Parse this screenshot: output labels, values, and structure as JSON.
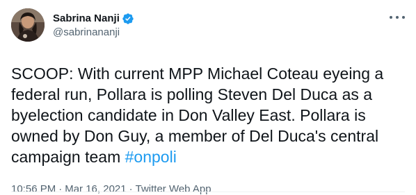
{
  "author": {
    "display_name": "Sabrina Nanji",
    "handle": "@sabrinananji",
    "avatar_icon": "profile-photo",
    "verified": true,
    "verified_color": "#1d9bf0"
  },
  "more_icon": "more-dots-icon",
  "tweet": {
    "text": "SCOOP: With current MPP Michael Coteau eyeing a federal run, Pollara is polling Steven Del Duca as a byelection candidate in Don Valley East. Pollara is owned by Don Guy, a member of Del Duca's central campaign team ",
    "hashtag": "#onpoli",
    "hashtag_color": "#1d9bf0"
  },
  "meta": {
    "time": "10:56 PM",
    "separator": "·",
    "date": "Mar 16, 2021",
    "source": "Twitter Web App"
  }
}
